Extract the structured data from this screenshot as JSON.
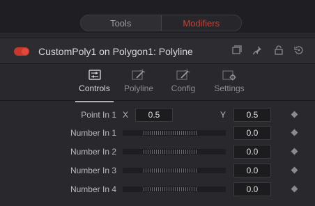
{
  "top_tabs": {
    "tools": "Tools",
    "modifiers": "Modifiers"
  },
  "header": {
    "title": "CustomPoly1 on Polygon1: Polyline"
  },
  "subtabs": [
    {
      "label": "Controls",
      "icon": "controls-icon",
      "active": true
    },
    {
      "label": "Polyline",
      "icon": "wand-icon",
      "active": false
    },
    {
      "label": "Config",
      "icon": "wand-icon",
      "active": false
    },
    {
      "label": "Settings",
      "icon": "settings-icon",
      "active": false
    }
  ],
  "point_in_1": {
    "label": "Point In 1",
    "x_label": "X",
    "x_value": "0.5",
    "y_label": "Y",
    "y_value": "0.5"
  },
  "number_inputs": [
    {
      "label": "Number In 1",
      "value": "0.0"
    },
    {
      "label": "Number In 2",
      "value": "0.0"
    },
    {
      "label": "Number In 3",
      "value": "0.0"
    },
    {
      "label": "Number In 4",
      "value": "0.0"
    }
  ],
  "colors": {
    "accent": "#d93a2e",
    "background": "#28282d"
  }
}
